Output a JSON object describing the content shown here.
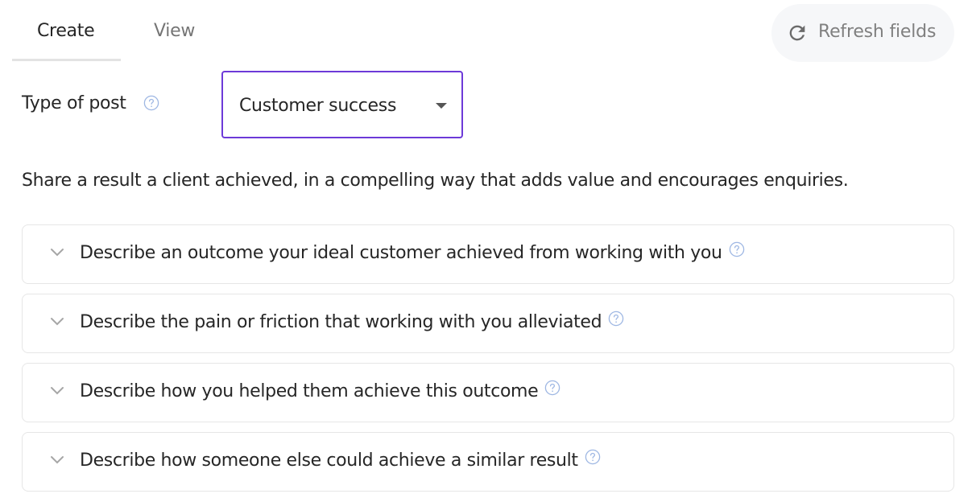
{
  "tabs": [
    {
      "label": "Create",
      "active": true
    },
    {
      "label": "View",
      "active": false
    }
  ],
  "refresh_button": {
    "label": "Refresh fields",
    "icon": "refresh-icon"
  },
  "type_of_post": {
    "label": "Type of post",
    "selected": "Customer success"
  },
  "description": "Share a result a client achieved, in a compelling way that adds value and encourages enquiries.",
  "accordion": [
    {
      "label": "Describe an outcome your ideal customer achieved from working with you"
    },
    {
      "label": "Describe the pain or friction that working with you alleviated"
    },
    {
      "label": "Describe how you helped them achieve this outcome"
    },
    {
      "label": "Describe how someone else could achieve a similar result"
    }
  ],
  "colors": {
    "accent": "#6d3ad8",
    "help_icon": "#9eb7e3",
    "muted_text": "#757575"
  }
}
